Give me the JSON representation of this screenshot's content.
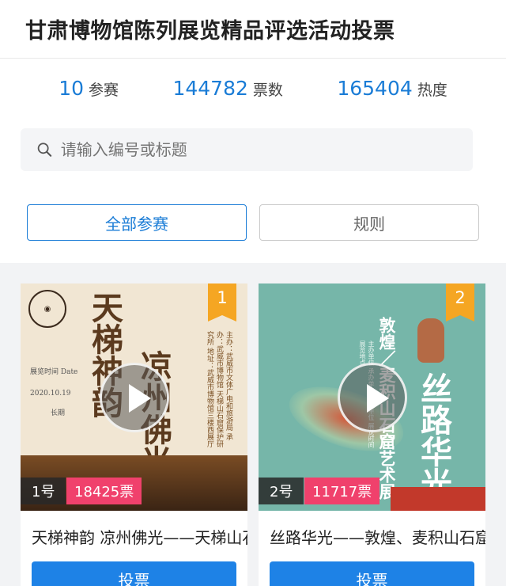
{
  "header": {
    "title": "甘肃博物馆陈列展览精品评选活动投票"
  },
  "stats": [
    {
      "num": "10",
      "label": "参赛"
    },
    {
      "num": "144782",
      "label": "票数"
    },
    {
      "num": "165404",
      "label": "热度"
    }
  ],
  "search": {
    "placeholder": "请输入编号或标题"
  },
  "tabs": [
    {
      "label": "全部参赛",
      "active": true
    },
    {
      "label": "规则",
      "active": false
    }
  ],
  "entries": [
    {
      "rank": "1",
      "number": "1号",
      "votes": "18425票",
      "title": "天梯神韵 凉州佛光——天梯山石窟艺术展",
      "button": "投票",
      "poster": {
        "headline_a": "天梯神韵",
        "headline_b": "凉州佛光",
        "side_text": "主办：武威市文体广电和旅游局 承办：武威市博物馆 天梯山石窟保护研究所 地址：武威市博物馆三楼西展厅",
        "date_label": "展览时间 Date",
        "date_value": "2020.10.19",
        "date_range": "长期"
      }
    },
    {
      "rank": "2",
      "number": "2号",
      "votes": "11717票",
      "title": "丝路华光——敦煌、麦积山石窟艺术展",
      "button": "投票",
      "poster": {
        "headline": "丝路华光",
        "sub": "敦煌／麦积山石窟艺术展",
        "side_text": "主办单位 承办单位 协办单位 展览时间 展览地点"
      }
    }
  ],
  "colors": {
    "accent": "#1a7cd6",
    "vote_tag": "#f0416c",
    "rank_badge": "#f5a623",
    "vote_button": "#1e82e6"
  }
}
